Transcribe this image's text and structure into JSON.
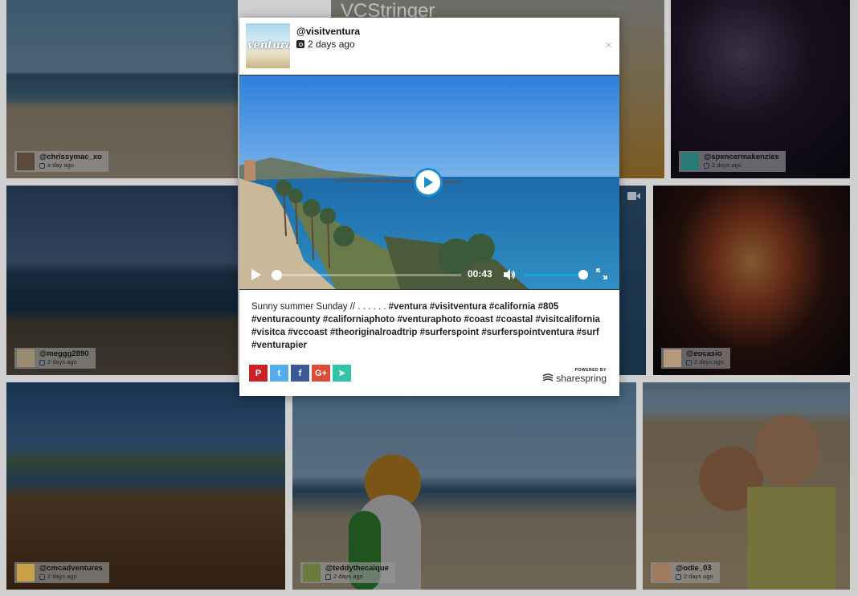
{
  "modal": {
    "username": "@visitventura",
    "time": "2 days ago",
    "avatar_text": "ventura",
    "close_label": "×",
    "video": {
      "duration": "00:43"
    },
    "caption_plain": "Sunny summer Sunday // . . . . . . ",
    "caption_tags_line1": "#ventura #visitventura #california #805",
    "caption_tags_rest": "#venturacounty #californiaphoto #venturaphoto #coast #coastal #visitcalifornia #visitca #vccoast #theoriginalroadtrip #surferspoint #surferspointventura #surf #venturapier",
    "share": [
      {
        "name": "pinterest",
        "glyph": "P",
        "color": "#cb2027"
      },
      {
        "name": "twitter",
        "glyph": "t",
        "color": "#55acee"
      },
      {
        "name": "facebook",
        "glyph": "f",
        "color": "#3b5998"
      },
      {
        "name": "googleplus",
        "glyph": "G+",
        "color": "#dd4b39"
      },
      {
        "name": "telegram",
        "glyph": "➤",
        "color": "#31c4a8"
      }
    ],
    "powered_by": "POWERED BY",
    "brand": "sharespring"
  },
  "watermark": "VCStringer",
  "tiles": [
    {
      "user": "@chrissymac_xo",
      "time": "a day ago"
    },
    {
      "user": "@spencermakenzies",
      "time": "2 days ago"
    },
    {
      "user": "@meggg2890",
      "time": "2 days ago"
    },
    {
      "user": "@eocasio",
      "time": "2 days ago"
    },
    {
      "user": "@cmcadventures",
      "time": "2 days ago"
    },
    {
      "user": "@teddythecaique",
      "time": "2 days ago"
    },
    {
      "user": "@odie_03",
      "time": "2 days ago"
    }
  ]
}
